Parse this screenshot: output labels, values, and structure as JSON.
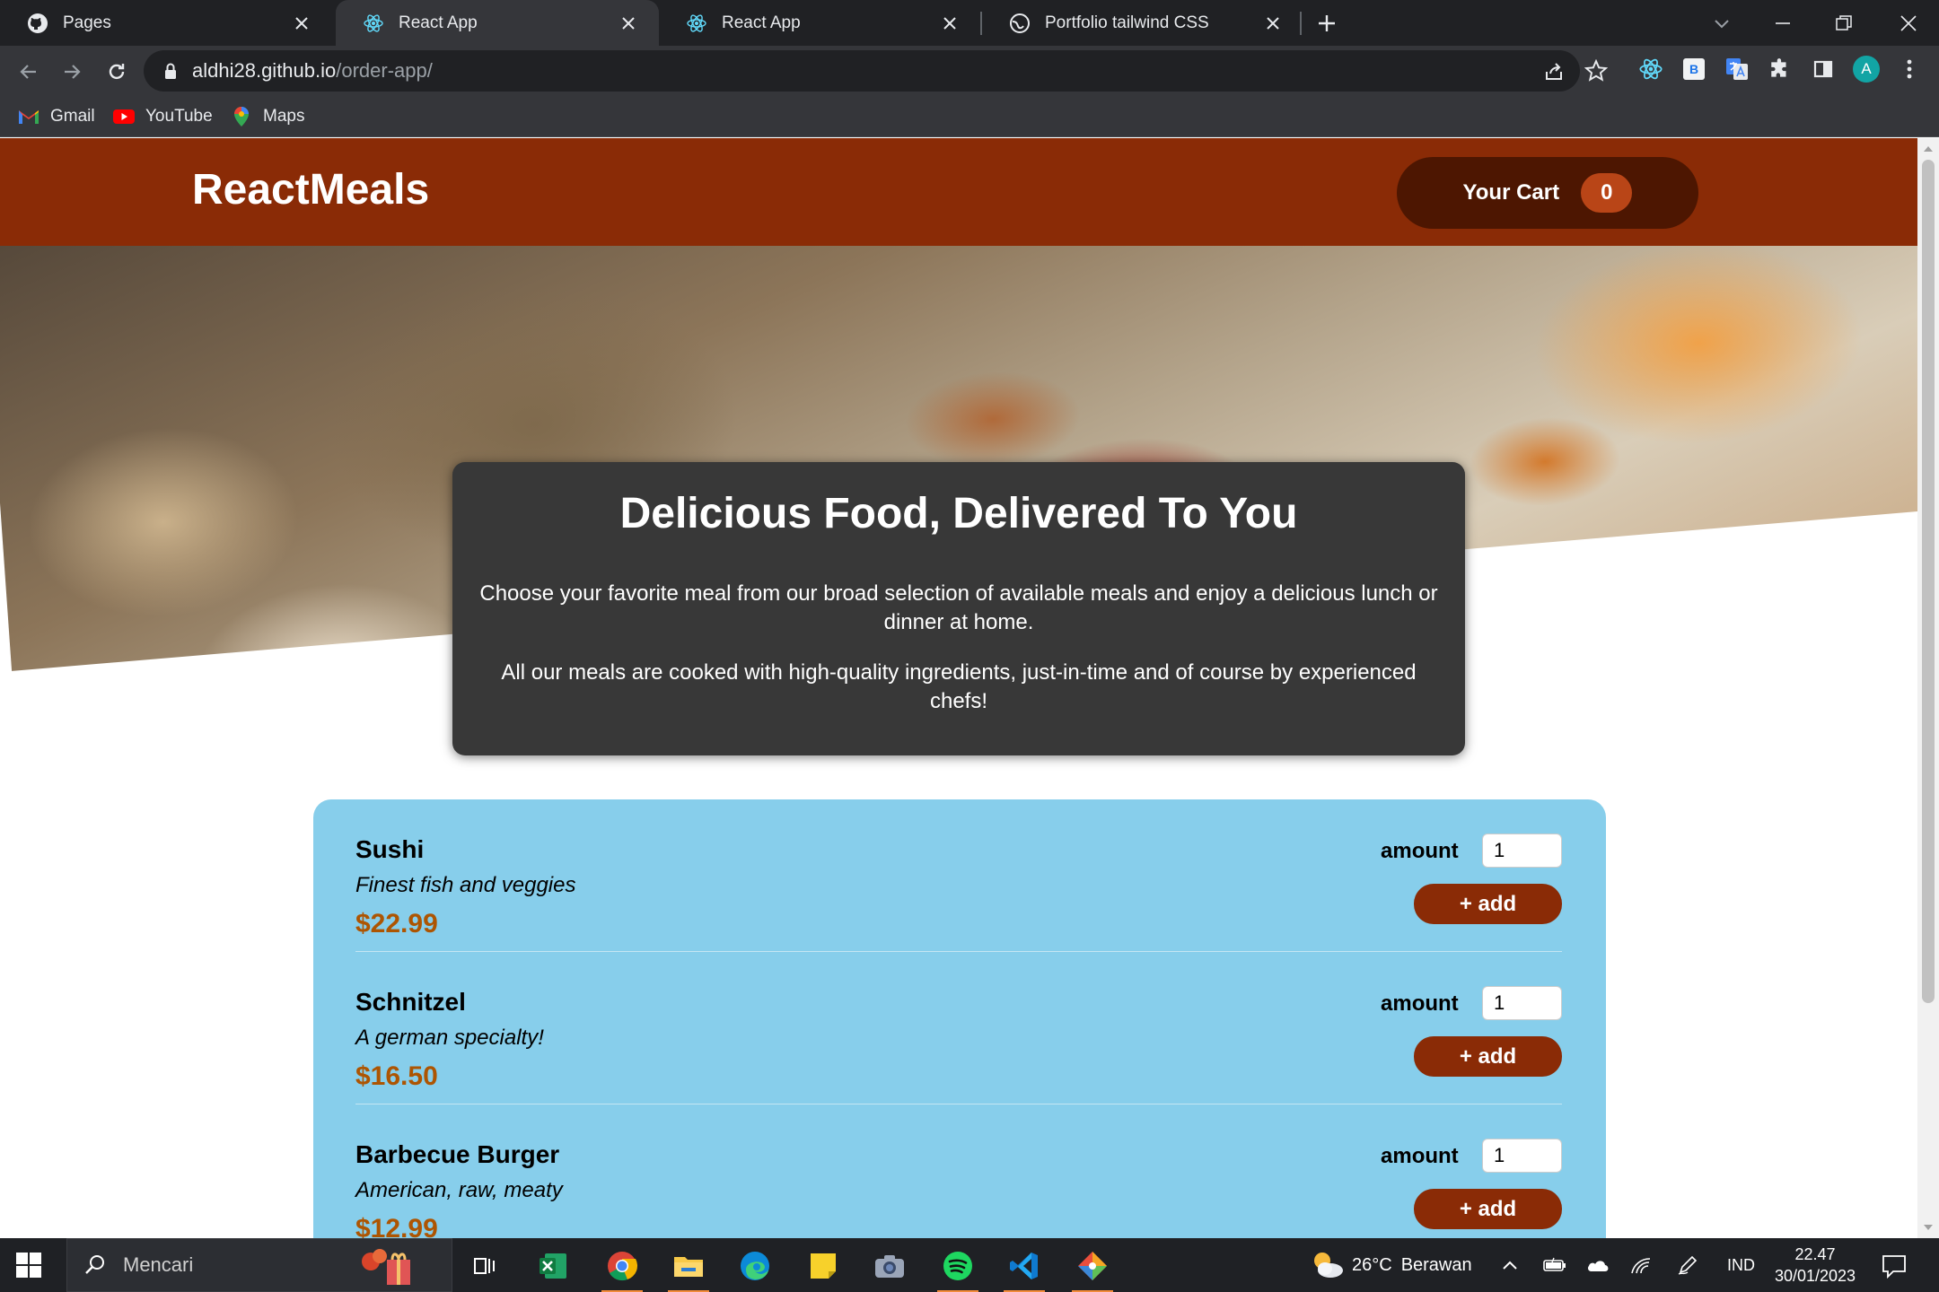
{
  "browser": {
    "tabs": [
      {
        "title": "Pages",
        "icon": "github-icon"
      },
      {
        "title": "React App",
        "icon": "react-icon"
      },
      {
        "title": "React App",
        "icon": "react-icon"
      },
      {
        "title": "Portfolio tailwind CSS",
        "icon": "globe-icon"
      }
    ],
    "url_host": "aldhi28.github.io",
    "url_path": "/order-app/",
    "bookmarks": [
      {
        "label": "Gmail",
        "icon": "gmail-icon"
      },
      {
        "label": "YouTube",
        "icon": "youtube-icon"
      },
      {
        "label": "Maps",
        "icon": "maps-icon"
      }
    ],
    "profile_initial": "A",
    "ext_b_label": "B"
  },
  "app": {
    "logo": "ReactMeals",
    "cart_label": "Your Cart",
    "cart_count": "0",
    "summary": {
      "title": "Delicious Food, Delivered To You",
      "p1": "Choose your favorite meal from our broad selection of available meals and enjoy a delicious lunch or dinner at home.",
      "p2": "All our meals are cooked with high-quality ingredients, just-in-time and of course by experienced chefs!"
    },
    "amount_label": "amount",
    "add_label": "+ add",
    "meals": [
      {
        "name": "Sushi",
        "description": "Finest fish and veggies",
        "price": "$22.99",
        "amount": "1"
      },
      {
        "name": "Schnitzel",
        "description": "A german specialty!",
        "price": "$16.50",
        "amount": "1"
      },
      {
        "name": "Barbecue Burger",
        "description": "American, raw, meaty",
        "price": "$12.99",
        "amount": "1"
      }
    ],
    "colors": {
      "header": "#8a2b06",
      "cart": "#4d1601",
      "badge": "#b94517",
      "meals_bg": "#87ceeb",
      "price": "#ad5502"
    }
  },
  "taskbar": {
    "search_placeholder": "Mencari",
    "temperature": "26°C",
    "weather": "Berawan",
    "language": "IND",
    "time": "22.47",
    "date": "30/01/2023"
  }
}
